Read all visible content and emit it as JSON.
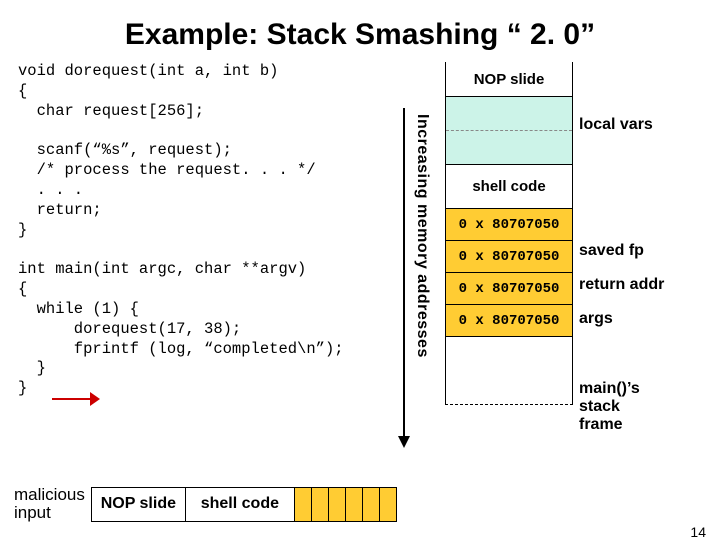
{
  "title": "Example: Stack Smashing “ 2. 0”",
  "code": "void dorequest(int a, int b)\n{\n  char request[256];\n\n  scanf(“%s”, request);\n  /* process the request. . . */\n  . . .\n  return;\n}\n\nint main(int argc, char **argv)\n{\n  while (1) {\n      dorequest(17, 38);\n      fprintf (log, “completed\\n”);\n  }\n}",
  "malicious": {
    "label": "malicious\ninput",
    "nop": "NOP slide",
    "shell": "shell code"
  },
  "axis_label": "Increasing memory addresses",
  "stack": {
    "nop": "NOP slide",
    "shell": "shell code",
    "addr": "0 x 80707050"
  },
  "labels": {
    "local": "local vars",
    "savedfp": "saved fp",
    "retaddr": "return addr",
    "args": "args",
    "mainframe": "main()’s\nstack\nframe"
  },
  "page": "14"
}
